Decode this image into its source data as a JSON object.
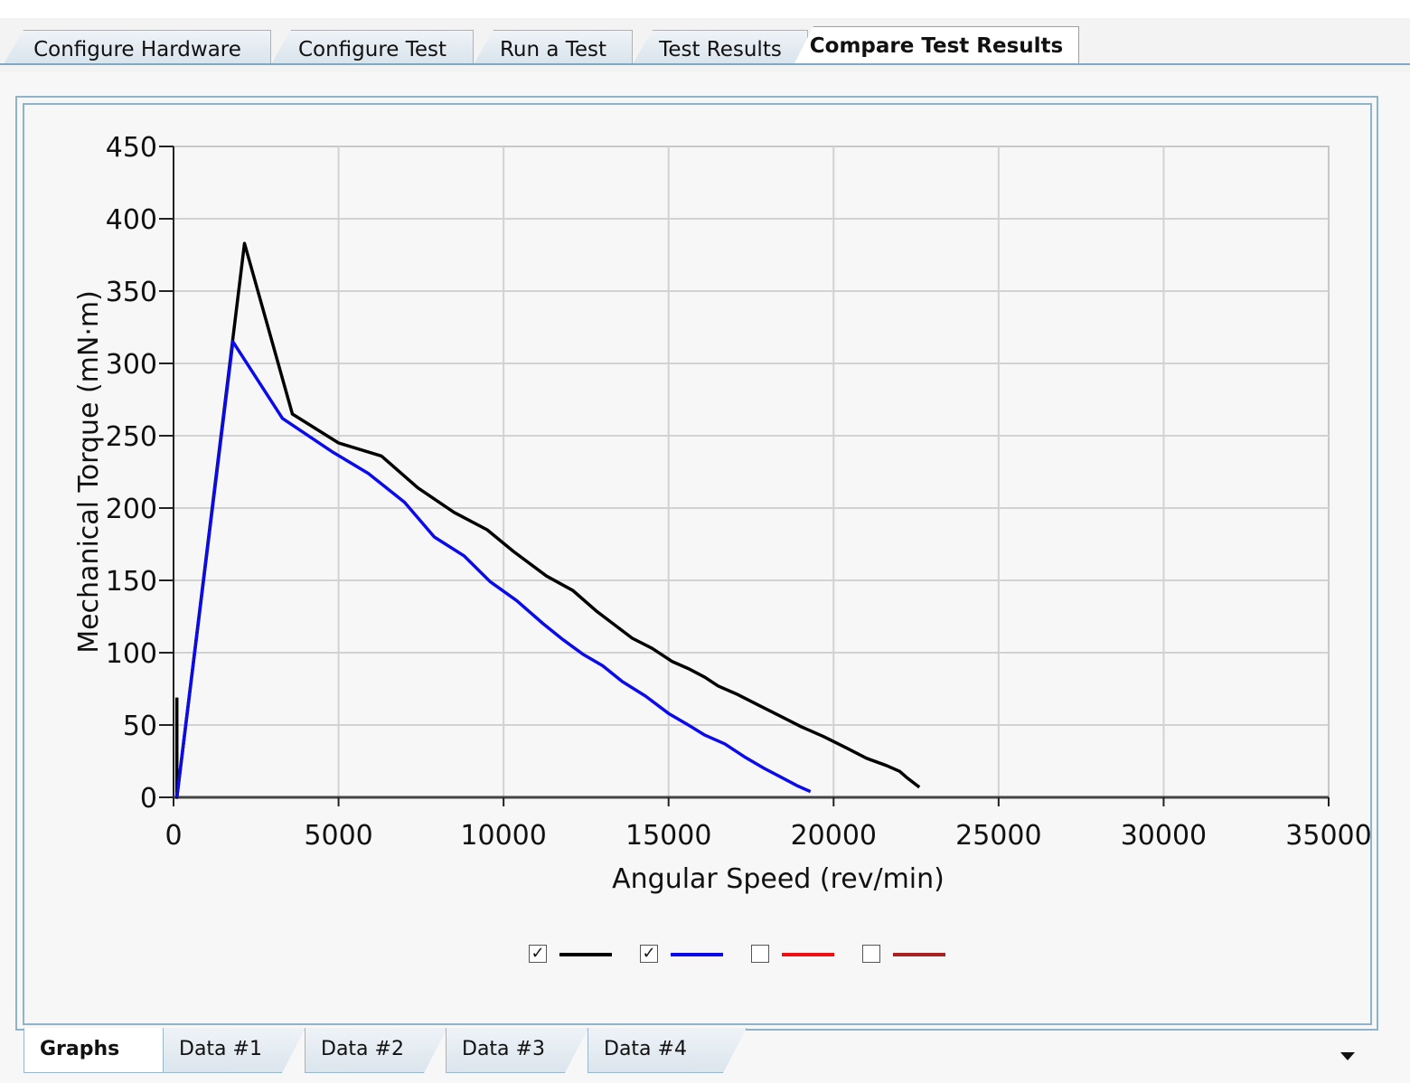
{
  "top_tabs": [
    {
      "label": "Configure Hardware",
      "active": false
    },
    {
      "label": "Configure Test",
      "active": false
    },
    {
      "label": "Run a Test",
      "active": false
    },
    {
      "label": "Test Results",
      "active": false
    },
    {
      "label": "Compare Test Results",
      "active": true
    }
  ],
  "bottom_tabs": [
    {
      "label": "Graphs",
      "active": true
    },
    {
      "label": "Data #1",
      "active": false
    },
    {
      "label": "Data #2",
      "active": false
    },
    {
      "label": "Data #3",
      "active": false
    },
    {
      "label": "Data #4",
      "active": false
    }
  ],
  "legend": [
    {
      "checked": true,
      "color": "#000000"
    },
    {
      "checked": true,
      "color": "#0b0bea"
    },
    {
      "checked": false,
      "color": "#ef1111"
    },
    {
      "checked": false,
      "color": "#a82222"
    }
  ],
  "chart_data": {
    "type": "line",
    "title": "",
    "xlabel": "Angular Speed (rev/min)",
    "ylabel": "Mechanical Torque (mN·m)",
    "xlim": [
      0,
      35000
    ],
    "ylim": [
      0,
      450
    ],
    "xticks": [
      0,
      5000,
      10000,
      15000,
      20000,
      25000,
      30000,
      35000
    ],
    "yticks": [
      0,
      50,
      100,
      150,
      200,
      250,
      300,
      350,
      400,
      450
    ],
    "grid": true,
    "series": [
      {
        "color": "#000000",
        "x": [
          100,
          100,
          2150,
          3600,
          5000,
          6300,
          7400,
          8500,
          9500,
          10300,
          11300,
          12100,
          12800,
          13900,
          14500,
          15100,
          15600,
          16100,
          16500,
          17100,
          17700,
          18400,
          19000,
          19700,
          20400,
          21000,
          21600,
          22000,
          22200,
          22600
        ],
        "y": [
          69,
          0,
          383,
          265,
          245,
          236,
          214,
          197,
          185,
          170,
          153,
          143,
          129,
          110,
          103,
          94,
          89,
          83,
          77,
          71,
          64,
          56,
          49,
          42,
          34,
          27,
          22,
          18,
          14,
          7
        ]
      },
      {
        "color": "#0b0bea",
        "x": [
          100,
          1800,
          3300,
          4800,
          5900,
          7000,
          7900,
          8800,
          9600,
          10400,
          11200,
          11800,
          12400,
          13000,
          13600,
          14300,
          15000,
          15600,
          16100,
          16700,
          17300,
          17900,
          18400,
          18900,
          19300
        ],
        "y": [
          0,
          315,
          262,
          239,
          224,
          204,
          180,
          167,
          149,
          136,
          120,
          109,
          99,
          91,
          80,
          70,
          58,
          50,
          43,
          37,
          28,
          20,
          14,
          8,
          4
        ]
      }
    ]
  }
}
